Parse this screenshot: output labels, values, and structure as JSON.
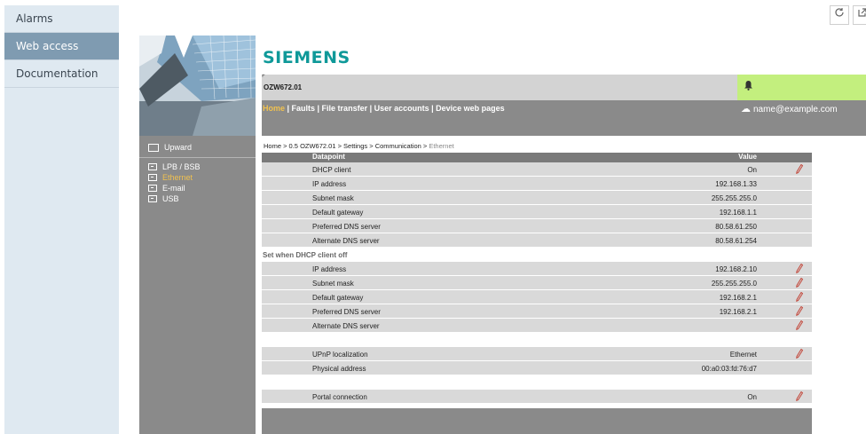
{
  "appnav": {
    "items": [
      {
        "label": "Alarms",
        "active": false
      },
      {
        "label": "Web access",
        "active": true
      },
      {
        "label": "Documentation",
        "active": false
      }
    ]
  },
  "toolbar": {
    "refresh_icon": "refresh-icon",
    "open_icon": "open-external-icon"
  },
  "device": {
    "logo": "SIEMENS",
    "title": "OZW672.01",
    "menu": {
      "home": "Home",
      "rest": " | Faults | File transfer | User accounts | Device web pages"
    },
    "user": "name@example.com",
    "colors": {
      "logo": "#0f9999",
      "alarm_bg": "#c3ef7e",
      "bars": "#8a8a8a"
    }
  },
  "side": {
    "upward": "Upward",
    "links": [
      {
        "label": "LPB / BSB",
        "selected": false
      },
      {
        "label": "Ethernet",
        "selected": true
      },
      {
        "label": "E-mail",
        "selected": false
      },
      {
        "label": "USB",
        "selected": false
      }
    ]
  },
  "breadcrumb": {
    "path": "Home > 0.5 OZW672.01 > Settings > Communication > ",
    "current": "Ethernet"
  },
  "table": {
    "headers": {
      "datapoint": "Datapoint",
      "value": "Value"
    },
    "group1": [
      {
        "name": "DHCP client",
        "value": "On",
        "editable": true
      },
      {
        "name": "IP address",
        "value": "192.168.1.33",
        "editable": false
      },
      {
        "name": "Subnet mask",
        "value": "255.255.255.0",
        "editable": false
      },
      {
        "name": "Default gateway",
        "value": "192.168.1.1",
        "editable": false
      },
      {
        "name": "Preferred DNS server",
        "value": "80.58.61.250",
        "editable": false
      },
      {
        "name": "Alternate DNS server",
        "value": "80.58.61.254",
        "editable": false
      }
    ],
    "section2": "Set when DHCP client off",
    "group2": [
      {
        "name": "IP address",
        "value": "192.168.2.10",
        "editable": true
      },
      {
        "name": "Subnet mask",
        "value": "255.255.255.0",
        "editable": true
      },
      {
        "name": "Default gateway",
        "value": "192.168.2.1",
        "editable": true
      },
      {
        "name": "Preferred DNS server",
        "value": "192.168.2.1",
        "editable": true
      },
      {
        "name": "Alternate DNS server",
        "value": "",
        "editable": true
      }
    ],
    "group3": [
      {
        "name": "UPnP localization",
        "value": "Ethernet",
        "editable": true
      },
      {
        "name": "Physical address",
        "value": "00:a0:03:fd:76:d7",
        "editable": false
      }
    ],
    "group4": [
      {
        "name": "Portal connection",
        "value": "On",
        "editable": true
      }
    ]
  }
}
